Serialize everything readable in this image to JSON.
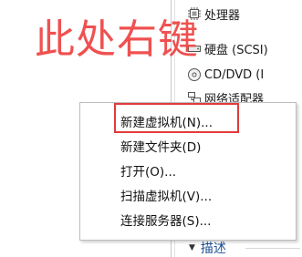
{
  "annotation": {
    "text": "此处右键"
  },
  "devices": [
    {
      "label": "处理器",
      "icon": "processor-icon"
    },
    {
      "label": "硬盘 (SCSI)",
      "icon": "hard-disk-icon"
    },
    {
      "label": "CD/DVD (I",
      "icon": "cd-dvd-icon"
    },
    {
      "label": "网络适配器",
      "icon": "network-adapter-icon"
    }
  ],
  "context_menu": {
    "items": [
      {
        "label": "新建虚拟机(N)...",
        "highlighted": true
      },
      {
        "label": "新建文件夹(D)"
      },
      {
        "label": "打开(O)..."
      },
      {
        "label": "扫描虚拟机(V)..."
      },
      {
        "label": "连接服务器(S)..."
      }
    ]
  },
  "section": {
    "label": "描述"
  },
  "colors": {
    "annotation": "#f05050",
    "highlight_border": "#e23b3b",
    "section_text": "#1d4f91"
  }
}
